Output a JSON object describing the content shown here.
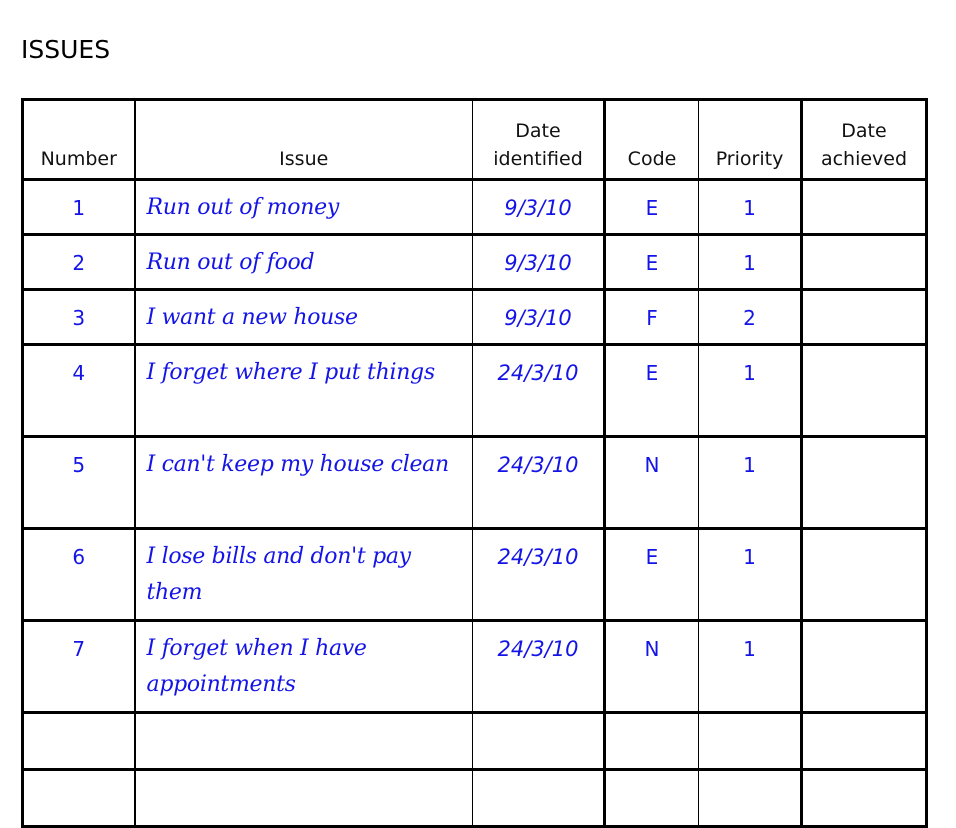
{
  "page": {
    "title": "ISSUES"
  },
  "table": {
    "headers": {
      "number": "Number",
      "issue": "Issue",
      "date_identified_line1": "Date",
      "date_identified_line2": "identified",
      "code": "Code",
      "priority": "Priority",
      "date_achieved_line1": "Date",
      "date_achieved_line2": "achieved"
    },
    "rows": [
      {
        "number": "1",
        "issue": "Run out of money",
        "date_identified": "9/3/10",
        "code": "E",
        "priority": "1",
        "date_achieved": ""
      },
      {
        "number": "2",
        "issue": "Run out of food",
        "date_identified": "9/3/10",
        "code": "E",
        "priority": "1",
        "date_achieved": ""
      },
      {
        "number": "3",
        "issue": "I want a new house",
        "date_identified": "9/3/10",
        "code": "F",
        "priority": "2",
        "date_achieved": ""
      },
      {
        "number": "4",
        "issue": "I forget where I put things",
        "date_identified": "24/3/10",
        "code": "E",
        "priority": "1",
        "date_achieved": ""
      },
      {
        "number": "5",
        "issue": "I can't keep my house clean",
        "date_identified": "24/3/10",
        "code": "N",
        "priority": "1",
        "date_achieved": ""
      },
      {
        "number": "6",
        "issue": "I lose bills and don't pay them",
        "date_identified": "24/3/10",
        "code": "E",
        "priority": "1",
        "date_achieved": ""
      },
      {
        "number": "7",
        "issue": "I forget when I have appointments",
        "date_identified": "24/3/10",
        "code": "N",
        "priority": "1",
        "date_achieved": ""
      },
      {
        "number": "",
        "issue": "",
        "date_identified": "",
        "code": "",
        "priority": "",
        "date_achieved": ""
      },
      {
        "number": "",
        "issue": "",
        "date_identified": "",
        "code": "",
        "priority": "",
        "date_achieved": ""
      }
    ]
  },
  "colors": {
    "handwriting": "#1414e6",
    "ink": "#000000",
    "background": "#ffffff"
  }
}
